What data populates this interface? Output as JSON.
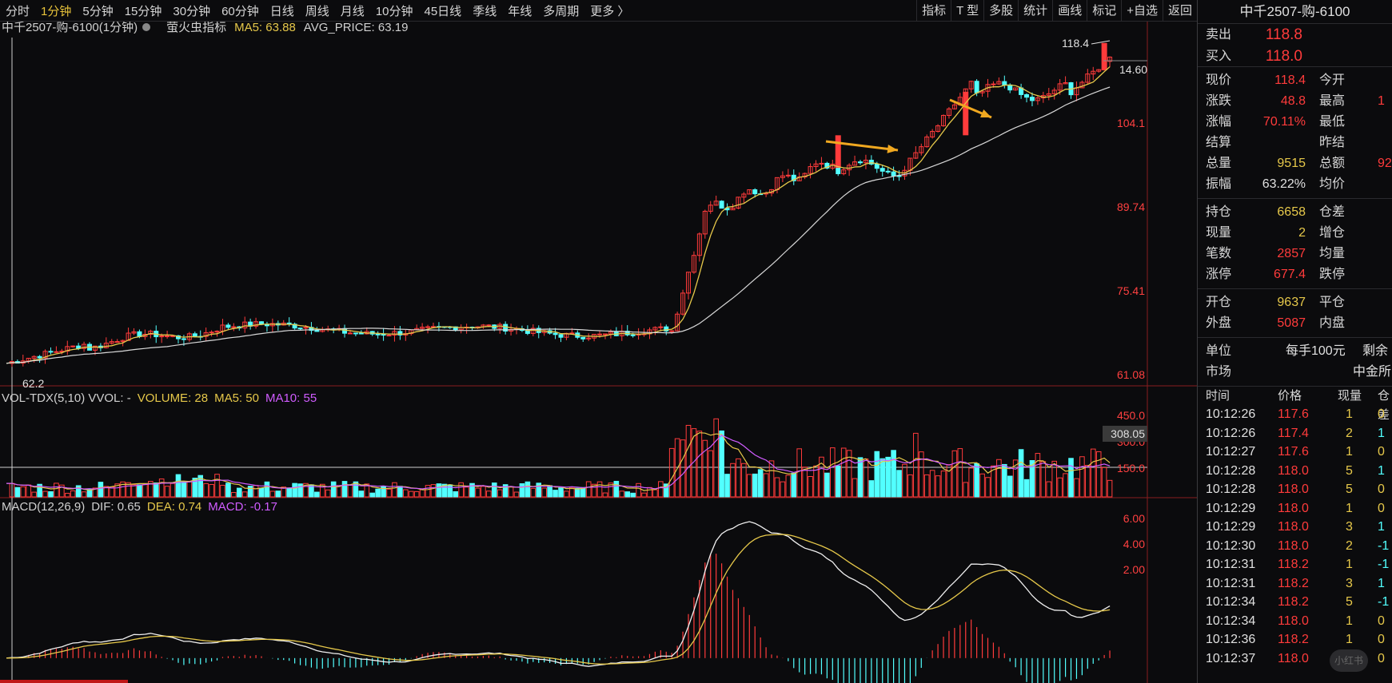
{
  "toolbar": {
    "timeframes": [
      "分时",
      "1分钟",
      "5分钟",
      "15分钟",
      "30分钟",
      "60分钟",
      "日线",
      "周线",
      "月线",
      "10分钟",
      "45日线",
      "季线",
      "年线",
      "多周期",
      "更多 〉"
    ],
    "active_timeframe": "1分钟",
    "right_buttons": [
      "指标",
      "T 型",
      "多股",
      "统计",
      "画线",
      "标记",
      "+自选",
      "返回"
    ]
  },
  "main_chart": {
    "title": "中千2507-购-6100(1分钟)",
    "indicator_name": "萤火虫指标",
    "ma5_label": "MA5: 63.88",
    "avg_label": "AVG_PRICE: 63.19",
    "price_axis": [
      "104.1",
      "89.74",
      "75.41",
      "61.08"
    ],
    "high_marker": "118.4",
    "low_marker": "62.2",
    "right_marker": "14.60",
    "colors": {
      "up": "#ff3b3b",
      "down": "#52ffff",
      "ma5": "#e6c84a",
      "avg": "#d8d8d8",
      "arrow": "#f0a820"
    }
  },
  "volume_chart": {
    "title": "VOL-TDX(5,10)  VVOL: -",
    "volume_label": "VOLUME: 28",
    "ma5_label": "MA5: 50",
    "ma10_label": "MA10: 55",
    "axis": [
      "450.0",
      "300.0",
      "150.0"
    ],
    "crosshair_value": "308.05"
  },
  "macd_chart": {
    "title": "MACD(12,26,9)",
    "dif_label": "DIF: 0.65",
    "dea_label": "DEA: 0.74",
    "macd_label": "MACD: -0.17",
    "axis": [
      "6.00",
      "4.00",
      "2.00"
    ]
  },
  "panel": {
    "title": "中千2507-购-6100",
    "sell_label": "卖出",
    "sell_value": "118.8",
    "buy_label": "买入",
    "buy_value": "118.0",
    "rows": [
      {
        "l": "现价",
        "v": "118.4",
        "vc": "red",
        "l2": "今开",
        "v2": ""
      },
      {
        "l": "涨跌",
        "v": "48.8",
        "vc": "red",
        "l2": "最高",
        "v2": "1"
      },
      {
        "l": "涨幅",
        "v": "70.11%",
        "vc": "red",
        "l2": "最低",
        "v2": ""
      },
      {
        "l": "结算",
        "v": "",
        "vc": "wht",
        "l2": "昨结",
        "v2": ""
      },
      {
        "l": "总量",
        "v": "9515",
        "vc": "yel",
        "l2": "总额",
        "v2": "92"
      },
      {
        "l": "振幅",
        "v": "63.22%",
        "vc": "wht",
        "l2": "均价",
        "v2": ""
      }
    ],
    "rows2": [
      {
        "l": "持仓",
        "v": "6658",
        "vc": "yel",
        "l2": "仓差",
        "v2": ""
      },
      {
        "l": "现量",
        "v": "2",
        "vc": "yel",
        "l2": "增仓",
        "v2": ""
      },
      {
        "l": "笔数",
        "v": "2857",
        "vc": "red",
        "l2": "均量",
        "v2": ""
      },
      {
        "l": "涨停",
        "v": "677.4",
        "vc": "red",
        "l2": "跌停",
        "v2": ""
      }
    ],
    "rows3": [
      {
        "l": "开仓",
        "v": "9637",
        "vc": "yel",
        "l2": "平仓",
        "v2": ""
      },
      {
        "l": "外盘",
        "v": "5087",
        "vc": "red",
        "l2": "内盘",
        "v2": ""
      }
    ],
    "unit_label": "单位",
    "unit_value": "每手100元",
    "unit_extra": "剩余",
    "market_label": "市场",
    "market_value": "中金所",
    "tick_headers": [
      "时间",
      "价格",
      "现量",
      "仓差"
    ],
    "ticks": [
      {
        "t": "10:12:26",
        "p": "117.6",
        "q": "1",
        "d": "0"
      },
      {
        "t": "10:12:26",
        "p": "117.4",
        "q": "2",
        "d": "1"
      },
      {
        "t": "10:12:27",
        "p": "117.6",
        "q": "1",
        "d": "0"
      },
      {
        "t": "10:12:28",
        "p": "118.0",
        "q": "5",
        "d": "1"
      },
      {
        "t": "10:12:28",
        "p": "118.0",
        "q": "5",
        "d": "0"
      },
      {
        "t": "10:12:29",
        "p": "118.0",
        "q": "1",
        "d": "0"
      },
      {
        "t": "10:12:29",
        "p": "118.0",
        "q": "3",
        "d": "1"
      },
      {
        "t": "10:12:30",
        "p": "118.0",
        "q": "2",
        "d": "-1"
      },
      {
        "t": "10:12:31",
        "p": "118.2",
        "q": "1",
        "d": "-1"
      },
      {
        "t": "10:12:31",
        "p": "118.2",
        "q": "3",
        "d": "1"
      },
      {
        "t": "10:12:34",
        "p": "118.2",
        "q": "5",
        "d": "-1"
      },
      {
        "t": "10:12:34",
        "p": "118.0",
        "q": "1",
        "d": "0"
      },
      {
        "t": "10:12:36",
        "p": "118.2",
        "q": "1",
        "d": "0"
      },
      {
        "t": "10:12:37",
        "p": "118.0",
        "q": "2",
        "d": "0"
      }
    ],
    "watermark": "小红书"
  }
}
